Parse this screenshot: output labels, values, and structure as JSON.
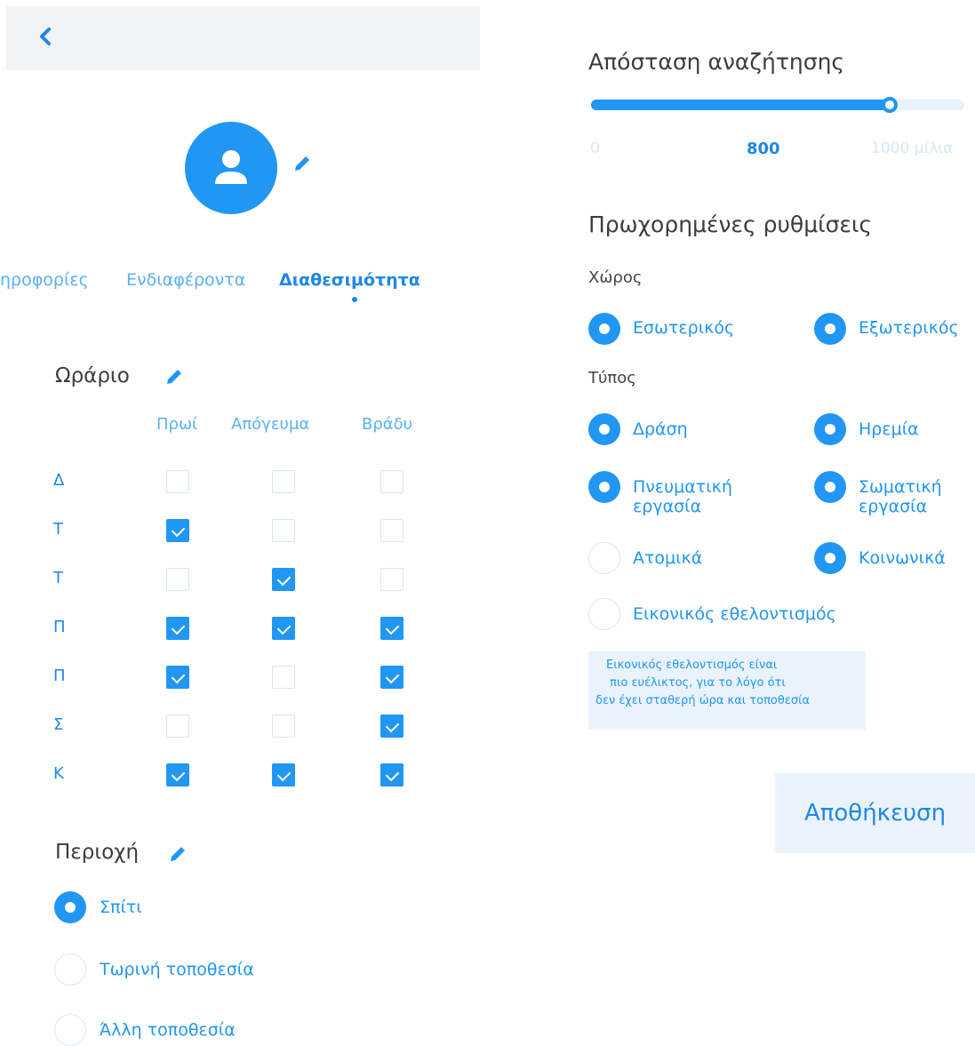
{
  "header": {
    "back_icon": "chevron-left-icon"
  },
  "profile": {
    "avatar_icon": "person-icon",
    "edit_icon": "pencil-icon"
  },
  "tabs": [
    {
      "label": "ηροφορίες"
    },
    {
      "label": "Ενδιαφέροντα"
    },
    {
      "label": "Διαθεσιμότητα",
      "active": true
    }
  ],
  "schedule": {
    "title": "Ωράριο",
    "columns": [
      "Πρωί",
      "Απόγευμα",
      "Βράδυ"
    ],
    "rows": [
      {
        "day": "Δ",
        "values": [
          false,
          false,
          false
        ]
      },
      {
        "day": "Τ",
        "values": [
          true,
          false,
          false
        ]
      },
      {
        "day": "Τ",
        "values": [
          false,
          true,
          false
        ]
      },
      {
        "day": "Π",
        "values": [
          true,
          true,
          true
        ]
      },
      {
        "day": "Π",
        "values": [
          true,
          false,
          true
        ]
      },
      {
        "day": "Σ",
        "values": [
          false,
          false,
          true
        ]
      },
      {
        "day": "Κ",
        "values": [
          true,
          true,
          true
        ]
      }
    ]
  },
  "area": {
    "title": "Περιοχή",
    "options": [
      {
        "label": "Σπίτι",
        "selected": true
      },
      {
        "label": "Τωρινή τοποθεσία",
        "selected": false
      },
      {
        "label": "Άλλη τοποθεσία",
        "selected": false
      }
    ]
  },
  "distance": {
    "title": "Απόσταση αναζήτησης",
    "min_label": "0",
    "value_label": "800",
    "max_label": "1000 μίλια",
    "value_fraction": 0.8
  },
  "advanced": {
    "title": "Πρωχορημένες ρυθμίσεις",
    "space_label": "Χώρος",
    "space_options": [
      {
        "label": "Εσωτερικός",
        "selected": true
      },
      {
        "label": "Εξωτερικός",
        "selected": true
      }
    ],
    "type_label": "Τύπος",
    "type_options": [
      {
        "label": "Δράση",
        "selected": true
      },
      {
        "label": "Ηρεμία",
        "selected": true
      },
      {
        "label": "Πνευματική εργασία",
        "selected": true
      },
      {
        "label": "Σωματική εργασία",
        "selected": true
      },
      {
        "label": "Ατομικά",
        "selected": false
      },
      {
        "label": "Κοινωνικά",
        "selected": true
      },
      {
        "label": "Εικονικός εθελοντισμός",
        "selected": false
      }
    ],
    "note_lines": [
      "Εικονικός εθελοντισμός είναι",
      " πιο ευέλικτος, για το λόγο ότι",
      "δεν έχει σταθερή ώρα και τοποθεσία"
    ]
  },
  "save_label": "Αποθήκευση",
  "colors": {
    "accent": "#2196f3",
    "light_bg": "#eaf3fb"
  }
}
